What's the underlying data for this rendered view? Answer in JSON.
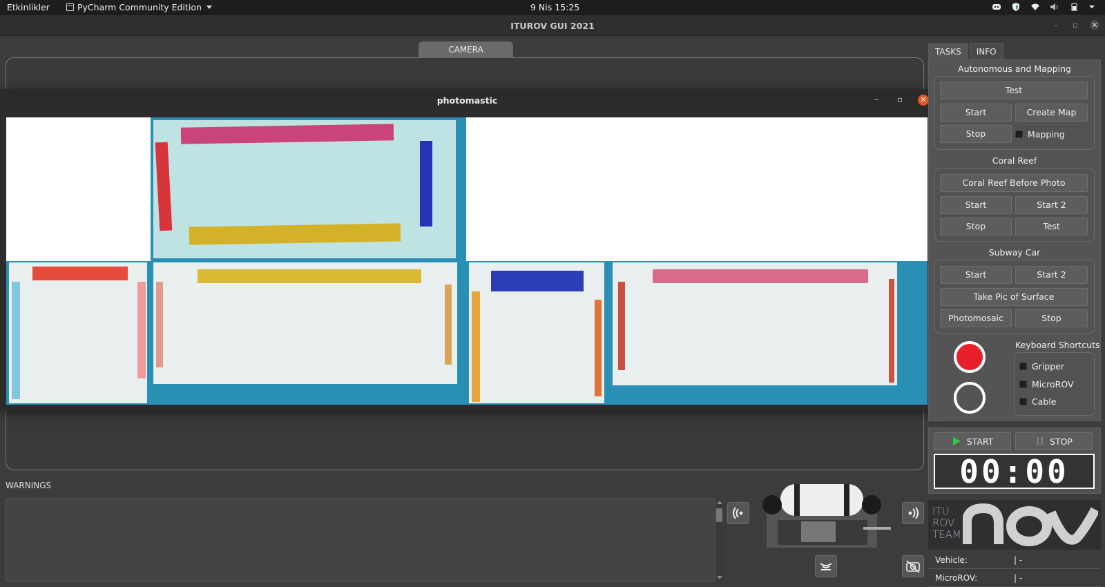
{
  "system": {
    "activities": "Etkinlikler",
    "app_name": "PyCharm Community Edition",
    "datetime": "9 Nis  15:25"
  },
  "window": {
    "title": "ITUROV GUI 2021"
  },
  "camera": {
    "tab_label": "CAMERA"
  },
  "photo_window": {
    "title": "photomastic"
  },
  "warnings": {
    "label": "WARNINGS",
    "text": ""
  },
  "right_tabs": [
    "TASKS",
    "INFO"
  ],
  "sections": {
    "autonomous": {
      "title": "Autonomous and Mapping",
      "test": "Test",
      "start": "Start",
      "create_map": "Create Map",
      "stop": "Stop",
      "mapping": "Mapping"
    },
    "coral": {
      "title": "Coral Reef",
      "before_photo": "Coral Reef Before Photo",
      "start": "Start",
      "start2": "Start 2",
      "stop": "Stop",
      "test": "Test"
    },
    "subway": {
      "title": "Subway Car",
      "start": "Start",
      "start2": "Start 2",
      "take_pic": "Take Pic of Surface",
      "photomosaic": "Photomosaic",
      "stop": "Stop"
    },
    "shortcuts": {
      "title": "Keyboard Shortcuts",
      "gripper": "Gripper",
      "microrov": "MicroROV",
      "cable": "Cable"
    }
  },
  "timer": {
    "start": "START",
    "stop": "STOP",
    "display": "00:00"
  },
  "logo": {
    "line1": "ITU",
    "line2": "ROV",
    "line3": "TEAM"
  },
  "status": {
    "vehicle_label": "Vehicle:",
    "vehicle_value": "| -",
    "microrov_label": "MicroROV:",
    "microrov_value": "| -"
  },
  "colors": {
    "record_red": "#e8202a",
    "accent_green": "#2ecc40",
    "close_orange": "#e95420"
  }
}
